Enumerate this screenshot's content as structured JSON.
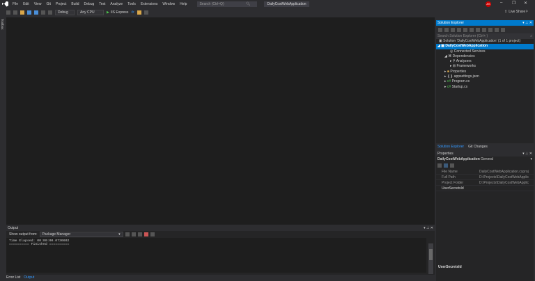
{
  "menu": [
    "File",
    "Edit",
    "View",
    "Git",
    "Project",
    "Build",
    "Debug",
    "Test",
    "Analyze",
    "Tools",
    "Extensions",
    "Window",
    "Help"
  ],
  "search_placeholder": "Search (Ctrl+Q)",
  "window_title": "DailyCostWebApplication",
  "avatar": "AS",
  "live_share": "Live Share",
  "toolbar": {
    "config": "Debug",
    "platform": "Any CPU",
    "run": "IIS Express"
  },
  "toolbox": "Toolbox",
  "solution_explorer": {
    "title": "Solution Explorer",
    "search": "Search Solution Explorer (Ctrl+;)",
    "items": [
      {
        "label": "Solution 'DailyCostWebApplication' (1 of 1 project)"
      },
      {
        "label": "DailyCostWebApplication"
      },
      {
        "label": "Connected Services"
      },
      {
        "label": "Dependencies"
      },
      {
        "label": "Analyzers"
      },
      {
        "label": "Frameworks"
      },
      {
        "label": "Properties"
      },
      {
        "label": "appsettings.json"
      },
      {
        "label": "Program.cs"
      },
      {
        "label": "Startup.cs"
      }
    ],
    "tabs": [
      "Solution Explorer",
      "Git Changes"
    ]
  },
  "properties": {
    "title": "Properties",
    "object": "DailyCostWebApplication",
    "category": "General",
    "rows": [
      {
        "name": "File Name",
        "value": "DailyCostWebApplication.csproj"
      },
      {
        "name": "Full Path",
        "value": "D:\\Projects\\DailyCostWebApplic"
      },
      {
        "name": "Project Folder",
        "value": "D:\\Projects\\DailyCostWebApplic"
      },
      {
        "name": "UserSecretsId",
        "value": ""
      }
    ],
    "description": "UserSecretsId"
  },
  "output": {
    "title": "Output",
    "show_from_label": "Show output from:",
    "source": "Package Manager",
    "lines": [
      "Time Elapsed: 00:00:00.0736602",
      "========== Finished =========="
    ]
  },
  "bottom_tabs": [
    "Error List",
    "Output"
  ]
}
